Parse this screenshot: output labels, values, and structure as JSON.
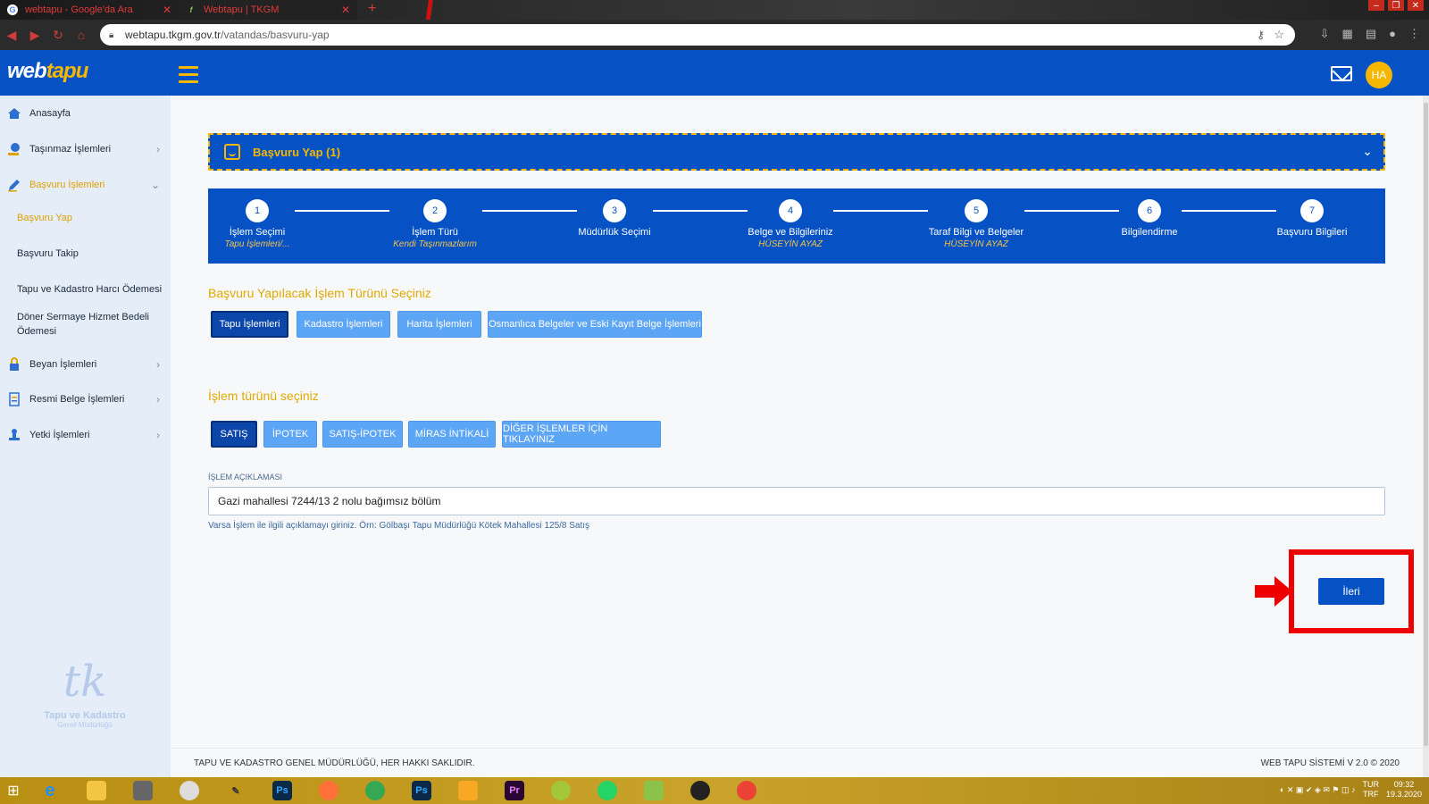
{
  "browser": {
    "tabs": [
      {
        "title": "webtapu - Google'da Ara"
      },
      {
        "title": "Webtapu | TKGM"
      }
    ],
    "url_host": "webtapu.tkgm.gov.tr",
    "url_path": "/vatandas/basvuru-yap"
  },
  "app": {
    "logo_part1": "web",
    "logo_part2": "tapu",
    "avatar_initials": "HA"
  },
  "sidebar": {
    "items": [
      {
        "label": "Anasayfa"
      },
      {
        "label": "Taşınmaz İşlemleri"
      },
      {
        "label": "Başvuru İşlemleri"
      },
      {
        "label": "Beyan İşlemleri"
      },
      {
        "label": "Resmi Belge İşlemleri"
      },
      {
        "label": "Yetki İşlemleri"
      }
    ],
    "subitems": [
      {
        "label": "Başvuru Yap"
      },
      {
        "label": "Başvuru Takip"
      },
      {
        "label": "Tapu ve Kadastro Harcı Ödemesi"
      },
      {
        "label": "Döner Sermaye Hizmet Bedeli Ödemesi"
      }
    ],
    "brand_name": "Tapu ve Kadastro",
    "brand_sub": "Genel Müdürlüğü"
  },
  "panel": {
    "title": "Başvuru Yap (1)"
  },
  "stepper": {
    "steps": [
      {
        "num": "1",
        "label": "İşlem Seçimi",
        "sub": "Tapu İşlemleri/..."
      },
      {
        "num": "2",
        "label": "İşlem Türü",
        "sub": "Kendi Taşınmazlarım"
      },
      {
        "num": "3",
        "label": "Müdürlük Seçimi",
        "sub": ""
      },
      {
        "num": "4",
        "label": "Belge ve Bilgileriniz",
        "sub": "HÜSEYİN AYAZ"
      },
      {
        "num": "5",
        "label": "Taraf Bilgi ve Belgeler",
        "sub": "HÜSEYİN AYAZ"
      },
      {
        "num": "6",
        "label": "Bilgilendirme",
        "sub": ""
      },
      {
        "num": "7",
        "label": "Başvuru Bilgileri",
        "sub": ""
      }
    ]
  },
  "category_section": {
    "title": "Başvuru Yapılacak İşlem Türünü Seçiniz",
    "buttons": [
      {
        "label": "Tapu İşlemleri"
      },
      {
        "label": "Kadastro İşlemleri"
      },
      {
        "label": "Harita İşlemleri"
      },
      {
        "label": "Osmanlıca Belgeler ve Eski Kayıt Belge İşlemleri"
      }
    ],
    "selected": "Tapu İşlemleri"
  },
  "type_section": {
    "title": "İşlem türünü seçiniz",
    "buttons": [
      {
        "label": "SATIŞ"
      },
      {
        "label": "İPOTEK"
      },
      {
        "label": "SATIŞ-İPOTEK"
      },
      {
        "label": "MİRAS İNTİKALİ"
      },
      {
        "label": "DİĞER İŞLEMLER İÇİN TIKLAYINIZ"
      }
    ],
    "selected": "SATIŞ"
  },
  "description": {
    "label": "İŞLEM AÇIKLAMASI",
    "value": "Gazi mahallesi 7244/13 2 nolu bağımsız bölüm",
    "hint": "Varsa İşlem ile ilgili açıklamayı giriniz. Örn: Gölbaşı Tapu Müdürlüğü Kötek Mahallesi 125/8 Satış"
  },
  "next_button": {
    "label": "İleri"
  },
  "footer": {
    "left": "TAPU VE KADASTRO GENEL MÜDÜRLÜĞÜ, HER HAKKI SAKLIDIR.",
    "right": "WEB TAPU SİSTEMİ V 2.0 © 2020"
  },
  "taskbar": {
    "lang": "TUR",
    "lang2": "TRF",
    "time": "09:32",
    "date": "19.3.2020"
  },
  "colors": {
    "primary": "#0652c5",
    "accent": "#f6b700",
    "highlight": "#e00000"
  }
}
